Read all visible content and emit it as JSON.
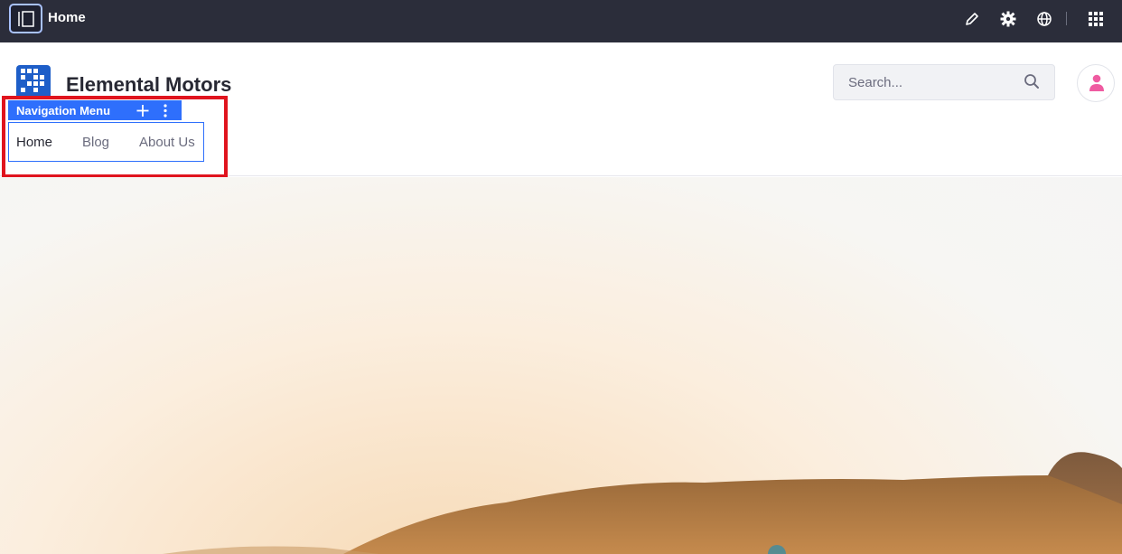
{
  "topbar": {
    "title": "Home",
    "icons": [
      "sidebar-toggle-icon",
      "pencil-icon",
      "gear-icon",
      "globe-icon",
      "apps-grid-icon"
    ]
  },
  "header": {
    "site_name": "Elemental Motors",
    "search": {
      "placeholder": "Search..."
    },
    "user_avatar": "user-icon"
  },
  "navigation_fragment": {
    "label": "Navigation Menu",
    "items": [
      {
        "label": "Home",
        "active": true
      },
      {
        "label": "Blog",
        "active": false
      },
      {
        "label": "About Us",
        "active": false
      }
    ]
  },
  "colors": {
    "topbar": "#2b2d3a",
    "accent": "#2e6ffc",
    "highlight": "#e0141e",
    "logo": "#1e5ec8",
    "avatar_icon": "#ef5ba1"
  }
}
